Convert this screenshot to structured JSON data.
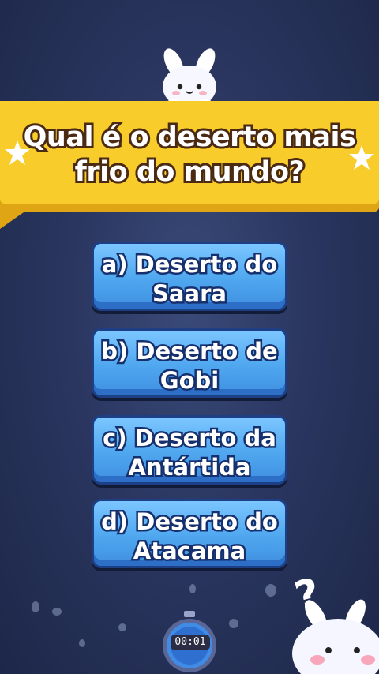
{
  "question": {
    "line1": "Qual é o deserto mais",
    "line2": "frio do mundo?"
  },
  "answers": [
    {
      "line1": "a) Deserto do",
      "line2": "Saara"
    },
    {
      "line1": "b) Deserto de",
      "line2": "Gobi"
    },
    {
      "line1": "c) Deserto da",
      "line2": "Antártida"
    },
    {
      "line1": "d) Deserto do",
      "line2": "Atacama"
    }
  ],
  "timer": {
    "text": "00:01"
  },
  "colors": {
    "banner": "#f8cc2a",
    "answer_button": "#4fa7ef",
    "text_outline": "#4a2a12",
    "background": "#2a3660"
  },
  "icons": [
    "bunny-mascot",
    "star",
    "question-mark",
    "stopwatch"
  ]
}
